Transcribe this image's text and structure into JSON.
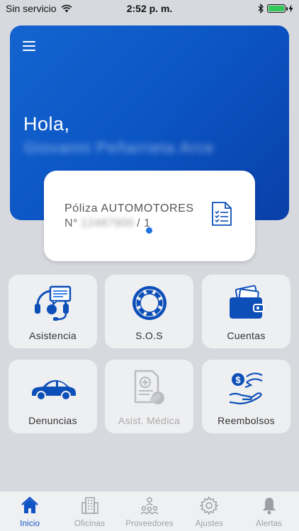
{
  "status_bar": {
    "carrier": "Sin servicio",
    "time": "2:52 p. m."
  },
  "header": {
    "greeting": "Hola,",
    "user_name": "Giovanni Peñarrieta Arce"
  },
  "policy": {
    "title": "Póliza AUTOMOTORES",
    "number_prefix": "N°",
    "number_redacted": "12487900",
    "number_suffix": "/ 1"
  },
  "tiles": [
    {
      "label": "Asistencia",
      "icon": "headset-chat-icon",
      "enabled": true
    },
    {
      "label": "S.O.S",
      "icon": "lifebuoy-icon",
      "enabled": true
    },
    {
      "label": "Cuentas",
      "icon": "wallet-icon",
      "enabled": true
    },
    {
      "label": "Denuncias",
      "icon": "car-icon",
      "enabled": true
    },
    {
      "label": "Asist. Médica",
      "icon": "medical-report-icon",
      "enabled": false
    },
    {
      "label": "Reembolsos",
      "icon": "money-hand-icon",
      "enabled": true
    }
  ],
  "nav": [
    {
      "label": "Inicio",
      "icon": "home-icon",
      "active": true
    },
    {
      "label": "Oficinas",
      "icon": "building-icon",
      "active": false
    },
    {
      "label": "Proveedores",
      "icon": "people-network-icon",
      "active": false
    },
    {
      "label": "Ajustes",
      "icon": "gear-icon",
      "active": false
    },
    {
      "label": "Alertas",
      "icon": "bell-icon",
      "active": false
    }
  ],
  "colors": {
    "brand": "#0b55c4",
    "accent_light": "#1f74e0",
    "icon_blue": "#0d4fb8",
    "background": "#d7d9de"
  }
}
